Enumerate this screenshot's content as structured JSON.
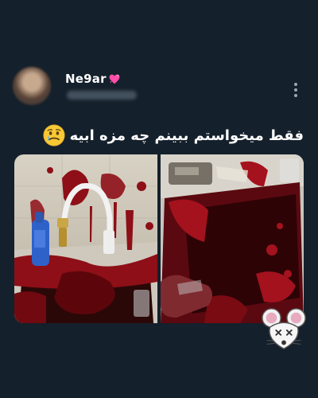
{
  "post": {
    "author": {
      "display_name": "Ne9ar",
      "name_icon": "pink-sparkling-heart-icon",
      "username_blurred": true,
      "avatar_blurred": true
    },
    "text": "فقط میخواستم ببینم چه مزه ابیه",
    "text_emoji": "tearful-smile-emoji-icon",
    "menu_icon": "vertical-dots-icon",
    "media": [
      {
        "name": "blood-splattered-sink-photo-left",
        "icon": "sink-photo"
      },
      {
        "name": "blood-filled-sink-photo-right",
        "icon": "sink-photo"
      }
    ],
    "watermark_icon": "mouse-sticker-icon"
  },
  "colors": {
    "background": "#14202b",
    "text": "#ffffff",
    "secondary": "#9aa6b2",
    "heart": "#ff4fa8"
  }
}
